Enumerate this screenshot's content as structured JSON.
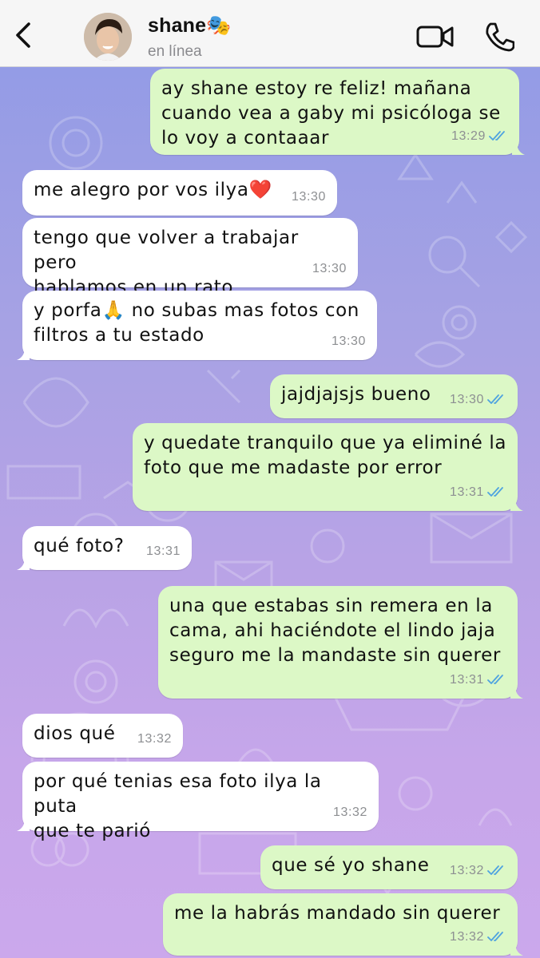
{
  "header": {
    "contact_name": "shane🎭",
    "status": "en línea"
  },
  "colors": {
    "incoming_bubble": "#ffffff",
    "outgoing_bubble": "#dcf8c6",
    "read_ticks": "#4fa3e0",
    "header_bg": "#f6f6f6"
  },
  "icons": {
    "back": "chevron-left-icon",
    "video": "video-camera-icon",
    "call": "phone-icon",
    "read": "double-check-icon"
  },
  "messages": [
    {
      "dir": "out",
      "text": "ay shane estoy re feliz! mañana\ncuando vea a gaby mi psicóloga se\nlo voy a contaaar",
      "time": "13:29",
      "read": true
    },
    {
      "dir": "in",
      "text": "me alegro por vos ilya❤️",
      "time": "13:30"
    },
    {
      "dir": "in",
      "text": "tengo que volver a trabajar pero\nhablamos en un rato",
      "time": "13:30"
    },
    {
      "dir": "in",
      "text": "y porfa🙏 no subas mas fotos con\nfiltros a tu estado",
      "time": "13:30"
    },
    {
      "dir": "out",
      "text": "jajdjajsjs bueno",
      "time": "13:30",
      "read": true
    },
    {
      "dir": "out",
      "text": "y quedate tranquilo que ya eliminé la\nfoto que me madaste por error",
      "time": "13:31",
      "read": true
    },
    {
      "dir": "in",
      "text": "qué foto?",
      "time": "13:31"
    },
    {
      "dir": "out",
      "text": "una que estabas sin remera en la\ncama, ahi haciéndote el lindo jaja\nseguro me la mandaste sin querer",
      "time": "13:31",
      "read": true
    },
    {
      "dir": "in",
      "text": "dios qué",
      "time": "13:32"
    },
    {
      "dir": "in",
      "text": "por qué tenias esa foto ilya la puta\nque te parió",
      "time": "13:32"
    },
    {
      "dir": "out",
      "text": "que sé yo shane",
      "time": "13:32",
      "read": true
    },
    {
      "dir": "out",
      "text": "me la habrás mandado sin querer",
      "time": "13:32",
      "read": true
    }
  ]
}
